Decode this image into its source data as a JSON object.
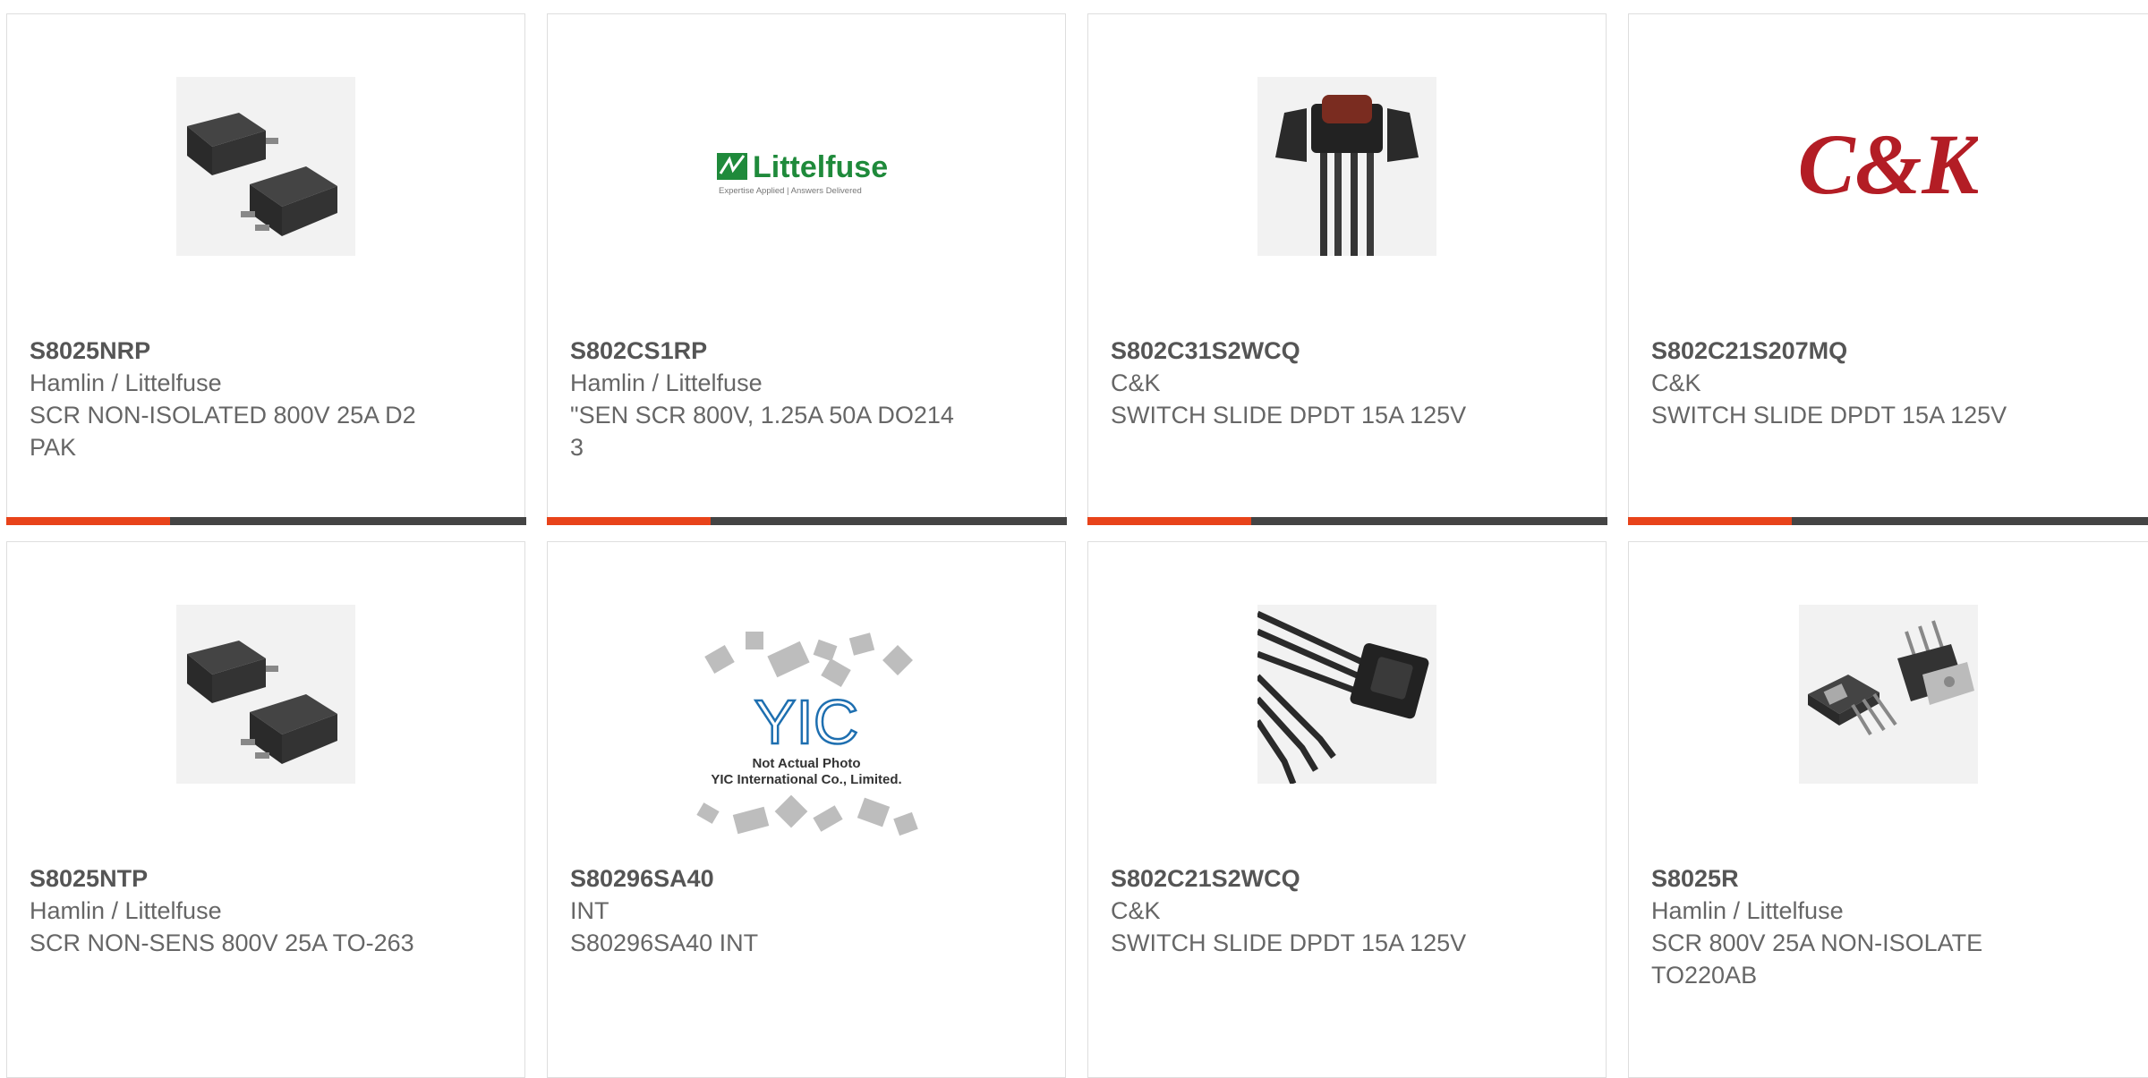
{
  "products": [
    {
      "part": "S8025NRP",
      "maker": "Hamlin / Littelfuse",
      "description": "SCR NON-ISOLATED 800V 25A D2 PAK",
      "image": "d2pak-chip-icon"
    },
    {
      "part": "S802CS1RP",
      "maker": "Hamlin / Littelfuse",
      "description": "\"SEN SCR 800V, 1.25A 50A DO214 3",
      "image": "littelfuse-logo",
      "logo_text": "Littelfuse",
      "logo_tag": "Expertise Applied | Answers Delivered"
    },
    {
      "part": "S802C31S2WCQ",
      "maker": "C&K",
      "description": "SWITCH SLIDE DPDT 15A 125V",
      "image": "rocker-switch-icon"
    },
    {
      "part": "S802C21S207MQ",
      "maker": "C&K",
      "description": "SWITCH SLIDE DPDT 15A 125V",
      "image": "ck-logo",
      "logo_text": "C&K"
    },
    {
      "part": "S8025NTP",
      "maker": "Hamlin / Littelfuse",
      "description": "SCR NON-SENS 800V 25A TO-263",
      "image": "d2pak-chip-icon"
    },
    {
      "part": "S80296SA40",
      "maker": "INT",
      "description": "S80296SA40 INT",
      "image": "yic-placeholder",
      "logo_text": "YIC",
      "logo_line1": "Not Actual Photo",
      "logo_line2": "YIC International Co., Limited."
    },
    {
      "part": "S802C21S2WCQ",
      "maker": "C&K",
      "description": "SWITCH SLIDE DPDT 15A 125V",
      "image": "switch-cable-icon"
    },
    {
      "part": "S8025R",
      "maker": "Hamlin / Littelfuse",
      "description": "SCR 800V 25A NON-ISOLATE TO220AB",
      "image": "to220-chip-icon"
    }
  ],
  "colors": {
    "accent": "#e8431a",
    "bar": "#444444",
    "border": "#dedede",
    "text": "#666666"
  }
}
